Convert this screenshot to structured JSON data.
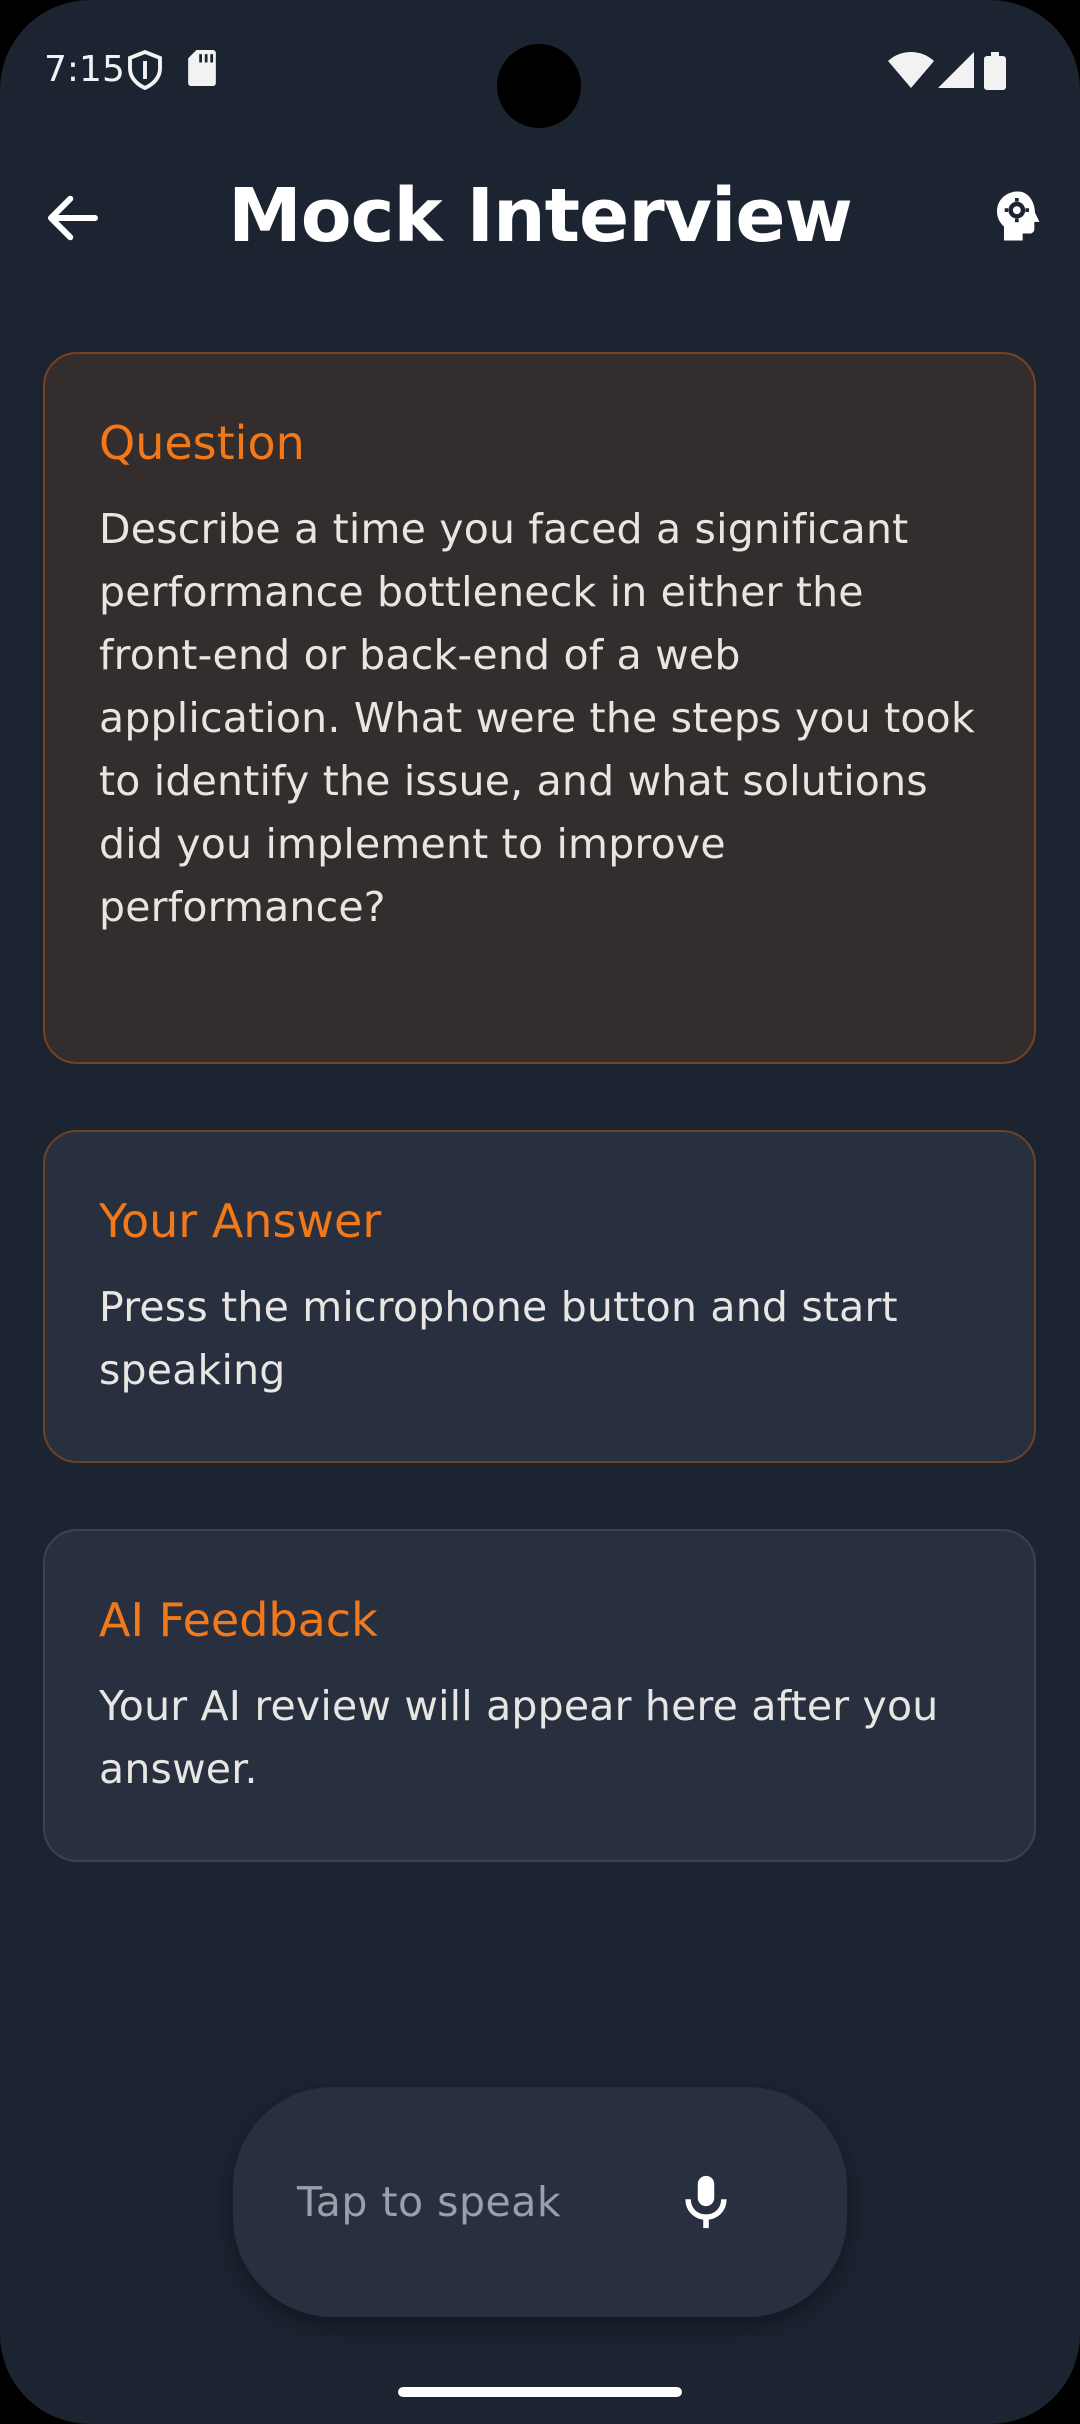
{
  "status_bar": {
    "time": "7:15",
    "icons": [
      "shield-icon",
      "sd-card-icon",
      "wifi-icon",
      "cell-signal-icon",
      "battery-icon"
    ]
  },
  "app_bar": {
    "title": "Mock Interview",
    "back_icon": "arrow-left-icon",
    "settings_icon": "gear-head-icon"
  },
  "question_card": {
    "title": "Question",
    "body": "Describe a time you faced a significant performance bottleneck in either the front-end or back-end of a web application. What were the steps you took to identify the issue, and what solutions did you implement to improve performance?"
  },
  "answer_card": {
    "title": "Your Answer",
    "body": "Press the microphone button and start speaking"
  },
  "feedback_card": {
    "title": "AI Feedback",
    "body": "Your AI review will appear here after you answer."
  },
  "speak_button": {
    "label": "Tap to speak",
    "icon": "microphone-icon"
  },
  "colors": {
    "background": "#1c2331",
    "accent": "#f2791a",
    "card_question_bg": "#332d2e",
    "card_bg": "#283040"
  }
}
